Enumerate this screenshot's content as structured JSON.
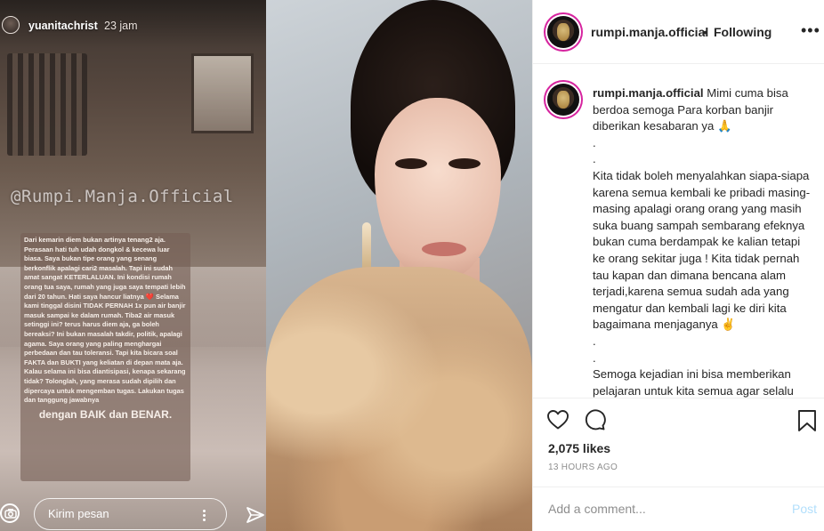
{
  "story": {
    "username": "yuanitachrist",
    "time": "23 jam",
    "watermark": "@Rumpi.Manja.Official",
    "text": "Dari kemarin diem bukan artinya tenang2 aja. Perasaan hati tuh udah dongkol & kecewa luar biasa. Saya bukan tipe orang yang senang berkonflik apalagi cari2 masalah. Tapi ini sudah amat sangat KETERLALUAN. Ini kondisi rumah orang tua saya, rumah yang juga saya tempati lebih dari 20 tahun. Hati saya hancur liatnya ❤️ Selama kami tinggal disini TIDAK PERNAH 1x pun air banjir masuk sampai ke dalam rumah. Tiba2 air masuk setinggi ini? terus harus diem aja, ga boleh bereaksi? Ini bukan masalah takdir, politik, apalagi agama. Saya orang yang paling menghargai perbedaan dan tau toleransi. Tapi kita bicara soal FAKTA dan BUKTI yang keliatan di depan mata aja. Kalau selama ini bisa diantisipasi, kenapa sekarang tidak? Tolonglah, yang merasa sudah dipilih dan dipercaya untuk mengemban tugas. Lakukan tugas dan tanggung jawabnya",
    "final_line": "dengan BAIK dan BENAR.",
    "reply_placeholder": "Kirim pesan"
  },
  "header": {
    "username": "rumpi.manja.official",
    "separator": "•",
    "follow_status": "Following",
    "more": "•••"
  },
  "caption": {
    "username": "rumpi.manja.official",
    "lines": [
      "Mimi cuma bisa berdoa semoga Para korban banjir diberikan kesabaran ya 🙏",
      ".",
      ".",
      "Kita tidak boleh menyalahkan siapa-siapa karena semua kembali ke pribadi masing-masing apalagi orang orang yang masih suka buang sampah sembarang efeknya bukan cuma berdampak ke kalian tetapi ke orang sekitar juga ! Kita tidak pernah tau kapan dan dimana bencana alam terjadi,karena semua sudah ada yang mengatur dan kembali lagi ke diri kita bagaimana menjaganya ✌️",
      ".",
      ".",
      "Semoga kejadian ini bisa memberikan pelajaran untuk kita semua agar selalu menjaga lingkungan"
    ]
  },
  "actions": {
    "likes": "2,075 likes",
    "time_ago": "13 HOURS AGO"
  },
  "comment": {
    "placeholder": "Add a comment...",
    "post_label": "Post"
  },
  "icons": [
    "heart-icon",
    "comment-icon",
    "bookmark-icon",
    "camera-icon",
    "send-icon",
    "more-icon"
  ]
}
